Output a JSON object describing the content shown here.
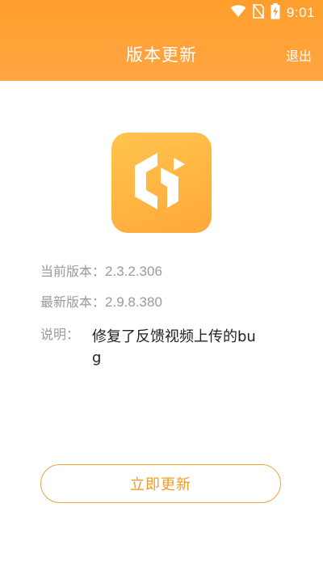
{
  "status_bar": {
    "time": "9:01",
    "icons": [
      "wifi-icon",
      "no-sim-icon",
      "battery-charging-icon"
    ]
  },
  "header": {
    "title": "版本更新",
    "exit_label": "退出"
  },
  "app": {
    "icon_name": "app-logo-icon",
    "brand_color": "#ffa83a"
  },
  "version": {
    "current_label": "当前版本：",
    "current_value": "2.3.2.306",
    "latest_label": "最新版本：",
    "latest_value": "2.9.8.380"
  },
  "description": {
    "label": "说明：",
    "text": "修复了反馈视频上传的bug"
  },
  "actions": {
    "update_label": "立即更新"
  },
  "colors": {
    "header_bg": "#ffa03a",
    "accent": "#f39a2a",
    "muted_text": "#9a9a9a",
    "body_text": "#222222"
  }
}
